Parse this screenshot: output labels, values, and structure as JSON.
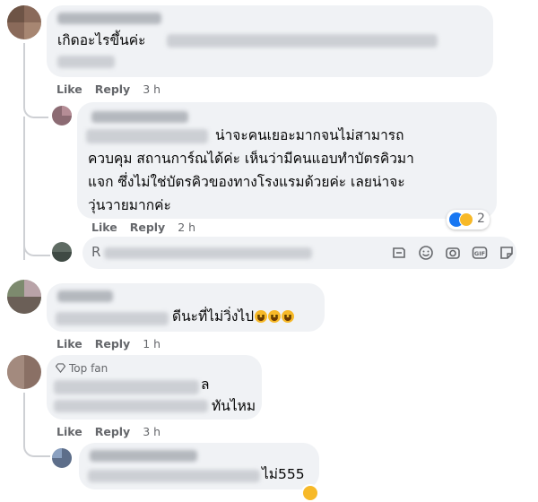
{
  "comments": [
    {
      "text": "เกิดอะไรขึ้นค่ะ",
      "actions": {
        "like": "Like",
        "reply": "Reply",
        "time": "3 h"
      }
    },
    {
      "lines": [
        "น่าจะคนเยอะมากจนไม่สามารถ",
        "ควบคุม สถานการ์ณได้ค่ะ เห็นว่ามีคนแอบทำบัตรคิวมา",
        "แจก ซึ่งไม่ใช่บัตรคิวของทางโรงแรมด้วยค่ะ เลยน่าจะ",
        "วุ่นวายมากค่ะ"
      ],
      "actions": {
        "like": "Like",
        "reply": "Reply",
        "time": "2 h"
      },
      "reaction_count": "2"
    },
    {
      "text": "ดีนะที่ไม่วิ่งไป",
      "actions": {
        "like": "Like",
        "reply": "Reply",
        "time": "1 h"
      }
    },
    {
      "badge": "Top fan",
      "line1": "ล",
      "line2": "ทันไหม",
      "actions": {
        "like": "Like",
        "reply": "Reply",
        "time": "3 h"
      }
    },
    {
      "text": "ไม่555"
    }
  ],
  "reply_box": {
    "visible_char": "R",
    "icons": [
      "sticker-icon",
      "emoji-icon",
      "camera-icon",
      "gif-icon",
      "sticker-face-icon"
    ],
    "gif_label": "GIF"
  },
  "colors": {
    "bubble": "#f0f2f5",
    "meta_text": "#65676b",
    "thread_line": "#ced0d4",
    "like_blue": "#1877f2",
    "emoji_yellow": "#f7b928"
  }
}
